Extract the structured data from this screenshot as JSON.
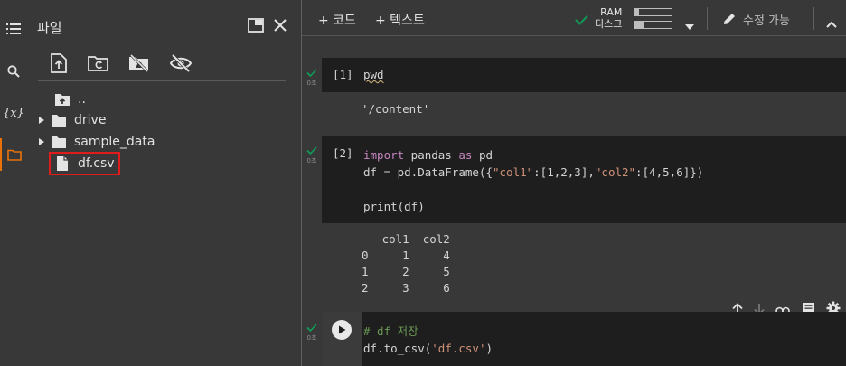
{
  "sidebar": {
    "rail": [
      {
        "icon": "table-of-contents-icon"
      },
      {
        "icon": "search-icon"
      },
      {
        "icon": "variables-icon",
        "label": "{x}"
      },
      {
        "icon": "folder-icon"
      }
    ]
  },
  "files": {
    "title": "파일",
    "tree": [
      {
        "name": "..",
        "type": "parent-folder"
      },
      {
        "name": "drive",
        "type": "folder"
      },
      {
        "name": "sample_data",
        "type": "folder"
      },
      {
        "name": "df.csv",
        "type": "file"
      }
    ]
  },
  "toolbar": {
    "add_code": "+ 코드",
    "add_text": "+ 텍스트",
    "ram_label": "RAM",
    "disk_label": "디스크",
    "ram_usage": 0.1,
    "disk_usage": 0.23,
    "edit_mode": "수정 가능"
  },
  "cells": [
    {
      "count": "[1]",
      "status": "0초",
      "output": "'/content'"
    },
    {
      "count": "[2]",
      "status": "0초",
      "output": "   col1  col2\n0     1     4\n1     2     5\n2     3     6"
    },
    {
      "status": "0초"
    }
  ],
  "colors": {
    "accent": "#e8710a",
    "highlight": "#e01b1b",
    "success": "#0f9d58"
  }
}
